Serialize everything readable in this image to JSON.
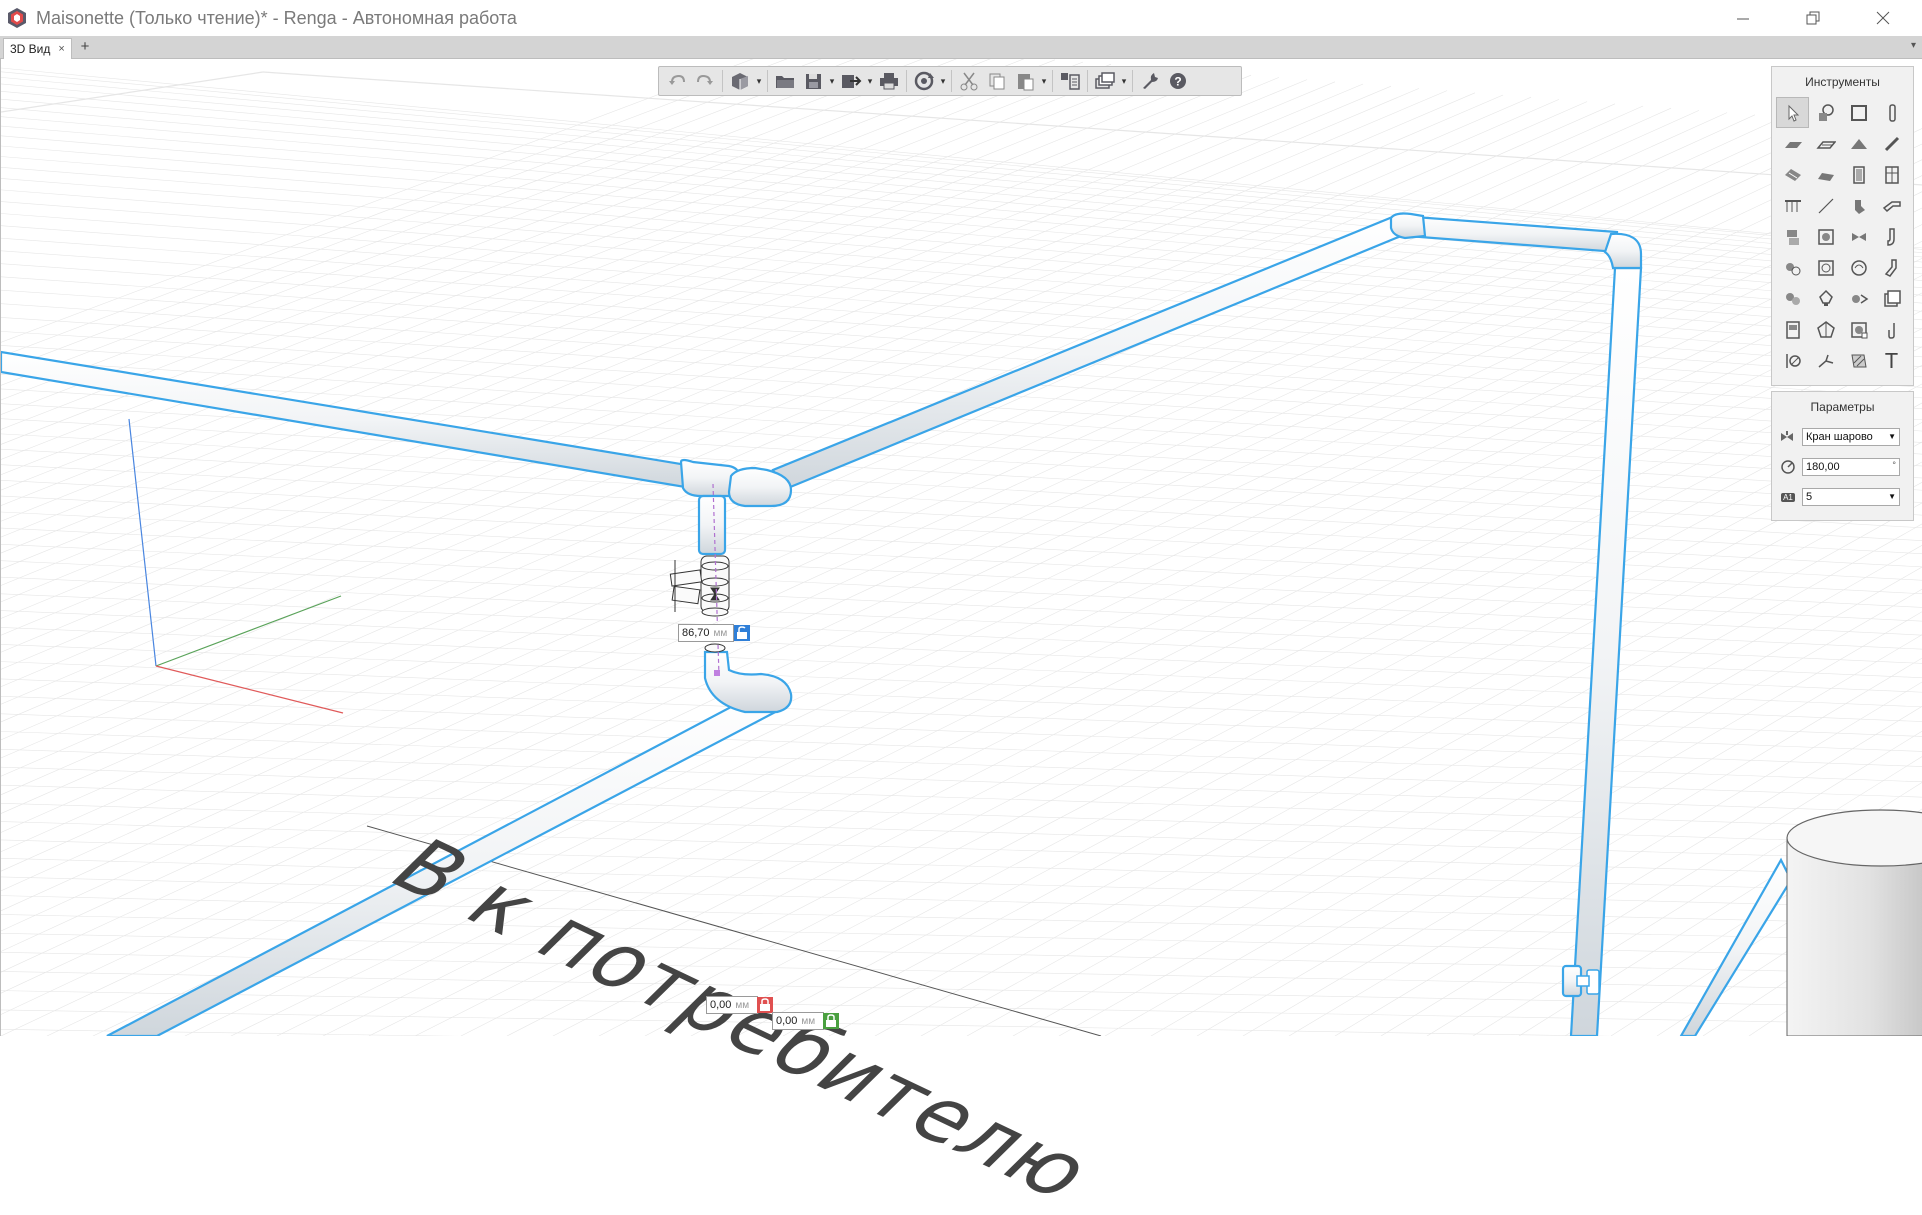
{
  "window": {
    "title": "Maisonette (Только чтение)* - Renga - Автономная работа",
    "controls": [
      "minimize",
      "restore",
      "close"
    ]
  },
  "tabs": {
    "active_label": "3D Вид",
    "close_glyph": "×",
    "add_glyph": "+",
    "menu_glyph": "▾"
  },
  "toolbar": {
    "buttons": [
      "undo-icon",
      "redo-icon",
      "view-cube-icon",
      "open-folder-icon",
      "save-icon",
      "export-icon",
      "print-icon",
      "sync-icon",
      "cut-icon",
      "copy-icon",
      "paste-icon",
      "properties-icon",
      "layers-icon",
      "settings-wrench-icon",
      "help-icon"
    ]
  },
  "tools_panel": {
    "title": "Инструменты",
    "tools": [
      "select",
      "assembly",
      "wall-opening",
      "column",
      "floor",
      "slab",
      "roof",
      "beam",
      "ramp",
      "stair",
      "door",
      "window",
      "railing",
      "line",
      "plumbing",
      "elbow",
      "equipment",
      "boiler",
      "valve",
      "pipe-fitting",
      "pump",
      "filter",
      "radiator",
      "duct-fitting",
      "sprinkler",
      "lamp",
      "fan",
      "panel",
      "cabinet",
      "socket",
      "meter",
      "bracket",
      "axis",
      "route",
      "hatch",
      "text"
    ],
    "text_tool_glyph": "T"
  },
  "params_panel": {
    "title": "Параметры",
    "style_value": "Кран шарово",
    "angle_value": "180,00",
    "angle_unit": "°",
    "level_value": "5",
    "level_badge": "A1"
  },
  "dimensions": {
    "valve_length": "86,70",
    "valve_unit": "мм",
    "offset_x": "0,00",
    "offset_y": "0,00",
    "offset_unit": "мм"
  },
  "floor_annotation": "В к потребителю",
  "colors": {
    "pipe_highlight": "#3aa5e8",
    "axis_x": "#e05a5a",
    "axis_y": "#5aa35a",
    "axis_z": "#4a86e0",
    "grid": "#e6e6e6"
  }
}
